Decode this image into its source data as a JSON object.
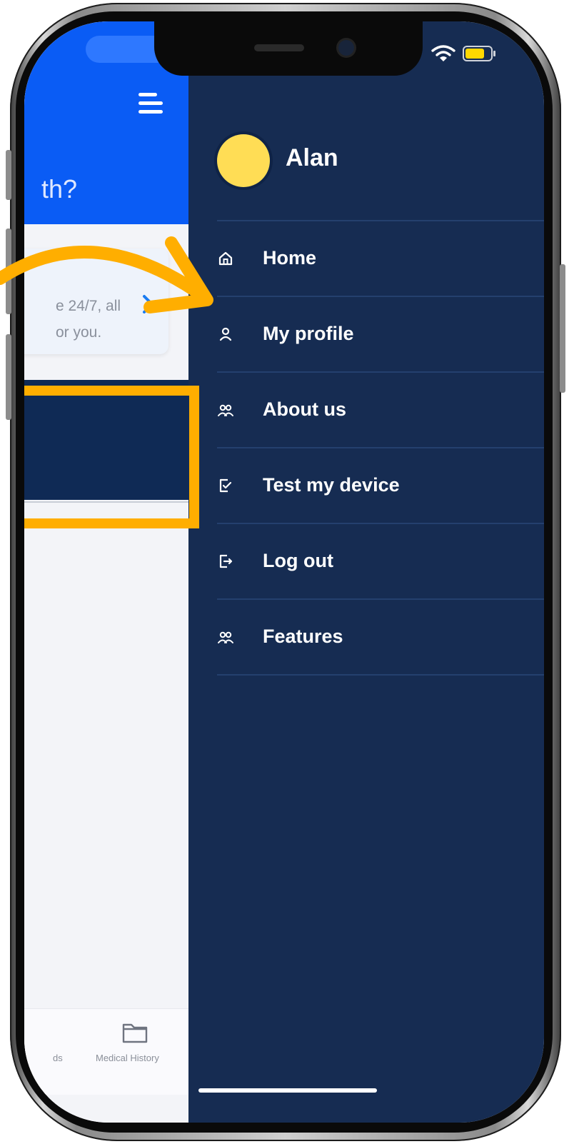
{
  "app": {
    "header_text": "th?",
    "card_line1": "e 24/7, all",
    "card_line2": "or you.",
    "tab_left_label": "ds",
    "tab_label": "Medical History"
  },
  "drawer": {
    "user_name": "Alan",
    "items": [
      {
        "label": "Home",
        "icon": "home-icon"
      },
      {
        "label": "My profile",
        "icon": "user-icon"
      },
      {
        "label": "About us",
        "icon": "users-icon"
      },
      {
        "label": "Test my device",
        "icon": "device-check-icon"
      },
      {
        "label": "Log out",
        "icon": "logout-icon"
      },
      {
        "label": "Features",
        "icon": "users-icon"
      }
    ]
  },
  "colors": {
    "drawer_bg": "#162c52",
    "header_blue": "#0a5cf5",
    "avatar": "#ffdd55",
    "annotation": "#ffae00",
    "battery": "#ffd800"
  }
}
